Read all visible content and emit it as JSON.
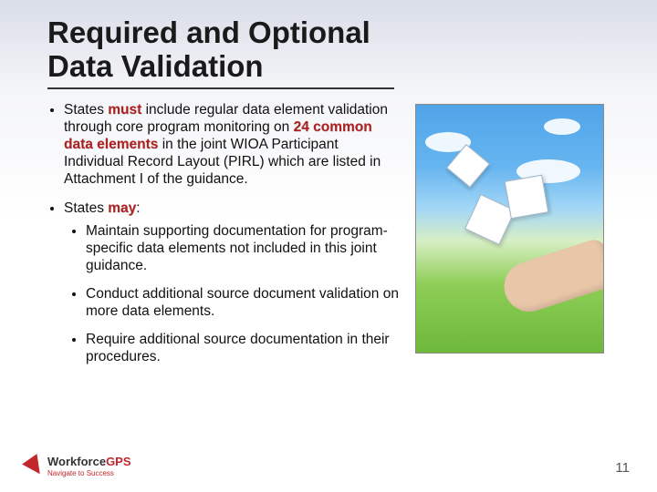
{
  "title": "Required and Optional Data Validation",
  "bullets": {
    "b1_pre": "States ",
    "b1_em1": "must",
    "b1_mid": " include regular data element validation through core program monitoring on ",
    "b1_em2": "24 common data elements",
    "b1_post": " in the joint WIOA Participant Individual Record Layout (PIRL) which are listed in Attachment I of the guidance.",
    "b2_pre": "States ",
    "b2_em": "may",
    "b2_post": ":",
    "b2a": "Maintain supporting documentation for program-specific data elements not included in this joint guidance.",
    "b2b": "Conduct additional source document validation on more data elements.",
    "b2c": "Require additional source documentation in their procedures."
  },
  "logo": {
    "word1": "Workforce",
    "word2": "GPS",
    "tagline": "Navigate to Success"
  },
  "page_number": "11",
  "image_alt": "Hand reaching toward floating puzzle pieces over sky and grass"
}
